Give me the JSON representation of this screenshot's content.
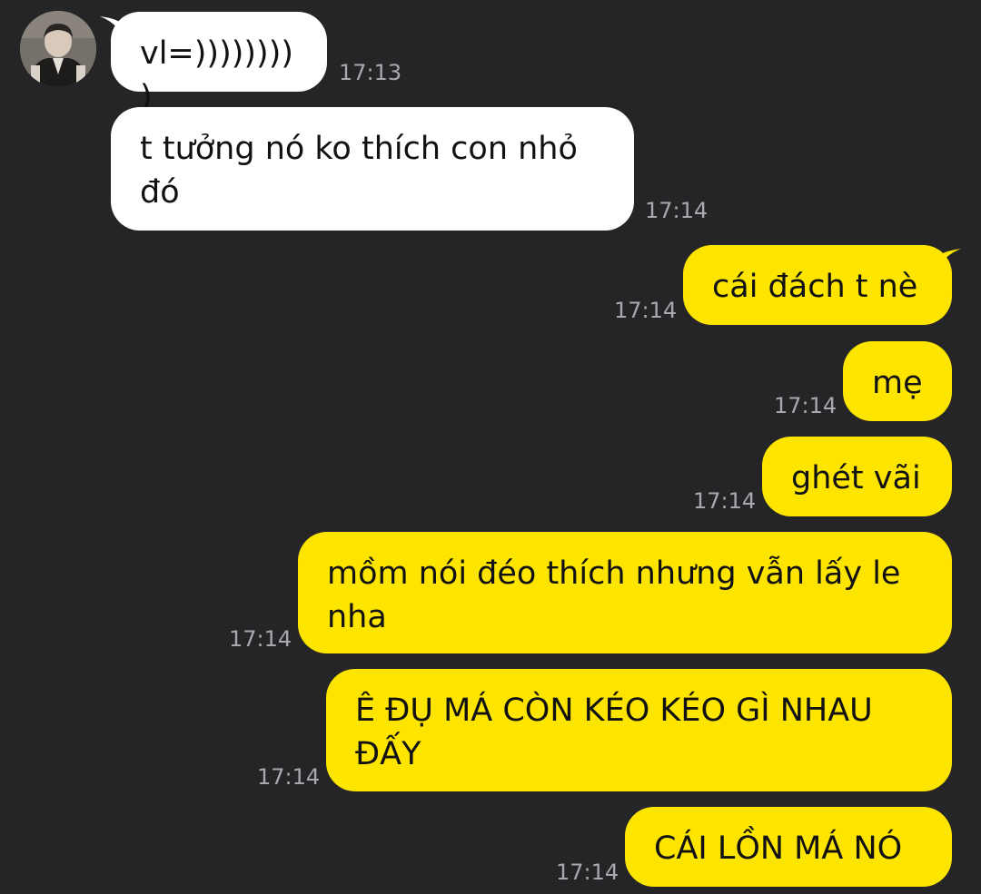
{
  "colors": {
    "background": "#252528",
    "incoming_bubble": "#ffffff",
    "outgoing_bubble": "#fee500",
    "timestamp": "#a9a9ad"
  },
  "messages": [
    {
      "direction": "incoming",
      "text": "vl=)))))))))",
      "time": "17:13"
    },
    {
      "direction": "incoming",
      "text": "t tưởng nó ko thích con nhỏ đó",
      "time": "17:14"
    },
    {
      "direction": "outgoing",
      "text": "cái đách t nè",
      "time": "17:14"
    },
    {
      "direction": "outgoing",
      "text": "mẹ",
      "time": "17:14"
    },
    {
      "direction": "outgoing",
      "text": "ghét vãi",
      "time": "17:14"
    },
    {
      "direction": "outgoing",
      "text": "mồm nói đéo thích nhưng vẫn lấy le nha",
      "time": "17:14"
    },
    {
      "direction": "outgoing",
      "text": "Ê ĐỤ MÁ CÒN KÉO KÉO GÌ NHAU ĐẤY",
      "time": "17:14"
    },
    {
      "direction": "outgoing",
      "text": "CÁI LỒN MÁ NÓ",
      "time": "17:14"
    }
  ]
}
